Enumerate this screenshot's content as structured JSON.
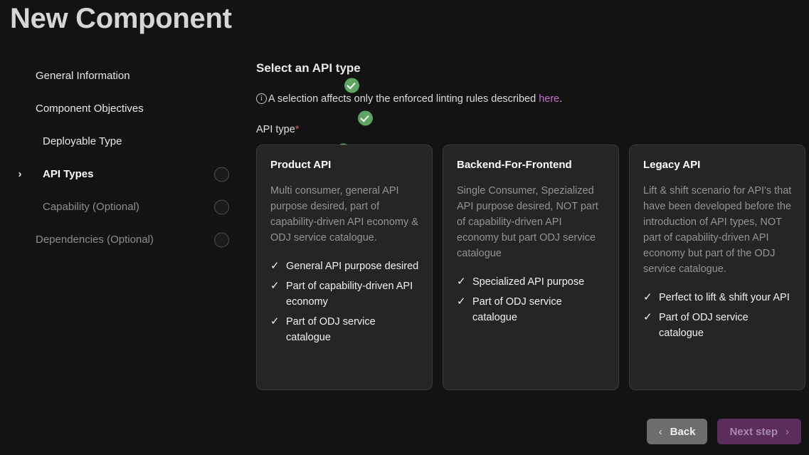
{
  "page": {
    "title": "New Component"
  },
  "stepper": {
    "items": [
      {
        "label": "General Information",
        "level": 0,
        "state": "done",
        "marker": "check-circle-icon",
        "chevron": false
      },
      {
        "label": "Component Objectives",
        "level": 0,
        "state": "done",
        "marker": "check-circle-icon",
        "chevron": false
      },
      {
        "label": "Deployable Type",
        "level": 1,
        "state": "done",
        "marker": "check-circle-icon",
        "chevron": false
      },
      {
        "label": "API Types",
        "level": 1,
        "state": "active",
        "marker": "empty-circle-icon",
        "chevron": true,
        "chevron_glyph": "›"
      },
      {
        "label": "Capability (Optional)",
        "level": 1,
        "state": "muted",
        "marker": "empty-circle-icon",
        "chevron": false
      },
      {
        "label": "Dependencies (Optional)",
        "level": 0,
        "state": "muted",
        "marker": "empty-circle-icon",
        "chevron": false
      }
    ]
  },
  "main": {
    "section_title": "Select an API type",
    "info": {
      "icon": "info-circle-icon",
      "text_before": "A selection affects only the enforced linting rules described ",
      "link_text": "here",
      "text_after": "."
    },
    "field_label": "API type",
    "required_marker": "*",
    "cards": [
      {
        "title": "Product API",
        "description": "Multi consumer, general API purpose desired, part of capability-driven API economy & ODJ service catalogue.",
        "features": [
          "General API purpose desired",
          "Part of capability-driven API economy",
          "Part of ODJ service catalogue"
        ]
      },
      {
        "title": "Backend-For-Frontend",
        "description": "Single Consumer, Spezialized API purpose desired, NOT part of capability-driven API economy but part ODJ service catalogue",
        "features": [
          "Specialized API purpose",
          "Part of ODJ service catalogue"
        ]
      },
      {
        "title": "Legacy API",
        "description": "Lift & shift scenario for API's that have been developed before the introduction of API types, NOT part of capability-driven API economy but part of the ODJ service catalogue.",
        "features": [
          "Perfect to lift & shift your API",
          "Part of ODJ service catalogue"
        ]
      }
    ],
    "check_glyph": "✓"
  },
  "footer": {
    "back_label": "Back",
    "back_chevron": "‹",
    "next_label": "Next step",
    "next_chevron": "›"
  },
  "colors": {
    "page_background": "#131313",
    "card_background": "#252525",
    "card_border": "#3b3b3b",
    "step_done_green": "#5fa463",
    "link_magenta": "#c56ec8",
    "required_red": "#e05d6b",
    "back_button": "#6d6d6d",
    "next_button": "#5a2d5c",
    "next_button_text": "#a98aab"
  }
}
